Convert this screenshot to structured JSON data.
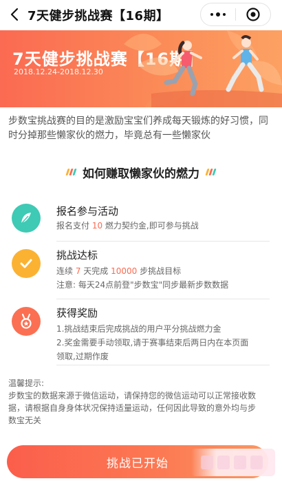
{
  "navbar": {
    "title": "7天健步挑战赛【16期】",
    "back_icon": "chevron-left-icon",
    "more_icon": "more-dots-icon",
    "close_icon": "target-close-icon"
  },
  "banner": {
    "title": "7天健步挑战赛【16期】",
    "dates": "2018.12.24-2018.12.30"
  },
  "intro": "步数宝挑战赛的目的是激励宝宝们养成每天锻炼的好习惯，同时分掉那些懒家伙的燃力，毕竟总有一些懒家伙",
  "section": {
    "title": "如何赚取懒家伙的燃力"
  },
  "steps": [
    {
      "title": "报名参与活动",
      "icon": "feather-icon",
      "line1": {
        "pre": "报名支付 ",
        "hl": "10",
        "post": " 燃力契约金,即可参与挑战"
      }
    },
    {
      "title": "挑战达标",
      "icon": "check-icon",
      "line1": {
        "pre": "连续 ",
        "hl1": "7",
        "mid": " 天完成 ",
        "hl2": "10000",
        "post": " 步挑战目标"
      },
      "line2": "注意: 每天24点前登\"步数宝\"同步最新步数数据"
    },
    {
      "title": "获得奖励",
      "icon": "medal-icon",
      "line1": "1.挑战结束后完成挑战的用户平分挑战燃力金",
      "line2": "2.奖金需要手动领取,请于赛事结束后两日内在本页面",
      "line3": "领取,过期作废"
    }
  ],
  "tips": {
    "heading": "温馨提示:",
    "line1": "步数宝的数据来源于微信运动，请保持您的微信运动可以正常接收数",
    "line2": "据，请根据自身身体状况保持适量运动，任何因此导致的意外均与步",
    "line3": "数宝无关"
  },
  "button": {
    "label": "挑战已开始"
  },
  "colors": {
    "accent": "#fb6a4f",
    "banner_start": "#fb6a52",
    "banner_end": "#fca163",
    "step1_icon": "#3ecab5",
    "step2_icon": "#fbb233",
    "step3_icon": "#fb7052"
  }
}
